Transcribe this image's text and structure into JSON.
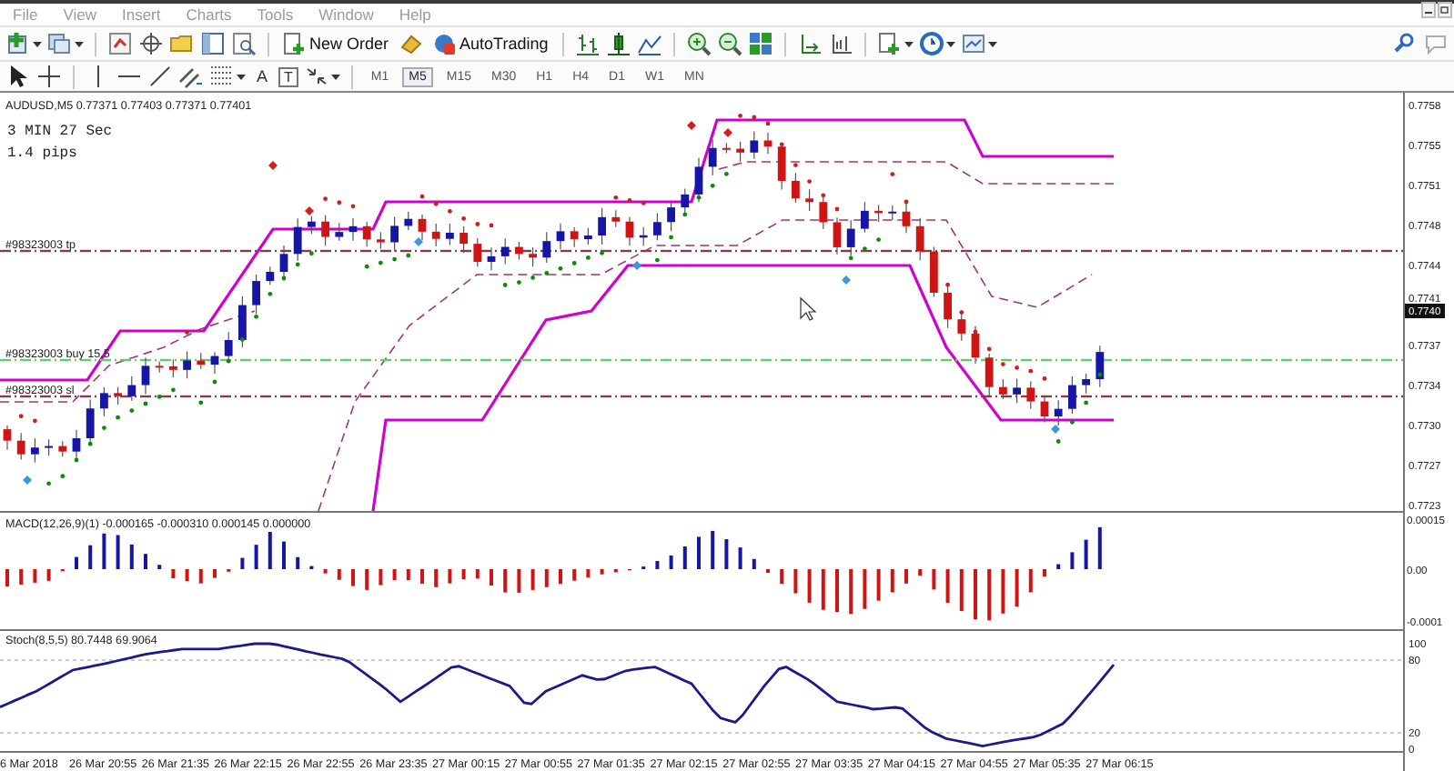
{
  "menu": [
    "File",
    "View",
    "Insert",
    "Charts",
    "Tools",
    "Window",
    "Help"
  ],
  "toolbar": {
    "new_order": "New Order",
    "autotrading": "AutoTrading"
  },
  "drawing_tools": {
    "text": "A",
    "label": "T"
  },
  "periods": [
    {
      "label": "M1",
      "selected": false
    },
    {
      "label": "M5",
      "selected": true
    },
    {
      "label": "M15",
      "selected": false
    },
    {
      "label": "M30",
      "selected": false
    },
    {
      "label": "H1",
      "selected": false
    },
    {
      "label": "H4",
      "selected": false
    },
    {
      "label": "D1",
      "selected": false
    },
    {
      "label": "W1",
      "selected": false
    },
    {
      "label": "MN",
      "selected": false
    }
  ],
  "chart": {
    "symbol_line": "AUDUSD,M5  0.77371 0.77403 0.77371 0.77401",
    "timer": "3 MIN 27 Sec",
    "spread": "1.4 pips",
    "order_lines": [
      {
        "label": "#98323003 tp",
        "color": "#8b3a4a"
      },
      {
        "label": "#98323003 buy 15.5",
        "color": "#66cc66"
      },
      {
        "label": "#98323003 sl",
        "color": "#8b3a4a"
      }
    ],
    "price_axis": [
      "0.7758",
      "0.7755",
      "0.7751",
      "0.7748",
      "0.7744",
      "0.7741",
      "0.7737",
      "0.7734",
      "0.7730",
      "0.7727",
      "0.7723"
    ],
    "current_price": "0.7740"
  },
  "macd": {
    "label": "MACD(12,26,9)(1) -0.000165 -0.000310 0.000145 0.000000",
    "axis": [
      "0.00015",
      "0.00",
      "-0.0001"
    ]
  },
  "stochastic": {
    "label": "Stoch(8,5,5) 80.7448 69.9064",
    "axis": [
      "100",
      "80",
      "20",
      "0"
    ]
  },
  "time_axis": [
    "6 Mar 2018",
    "26 Mar 20:55",
    "26 Mar 21:35",
    "26 Mar 22:15",
    "26 Mar 22:55",
    "26 Mar 23:35",
    "27 Mar 00:15",
    "27 Mar 00:55",
    "27 Mar 01:35",
    "27 Mar 02:15",
    "27 Mar 02:55",
    "27 Mar 03:35",
    "27 Mar 04:15",
    "27 Mar 04:55",
    "27 Mar 05:35",
    "27 Mar 06:15"
  ]
}
